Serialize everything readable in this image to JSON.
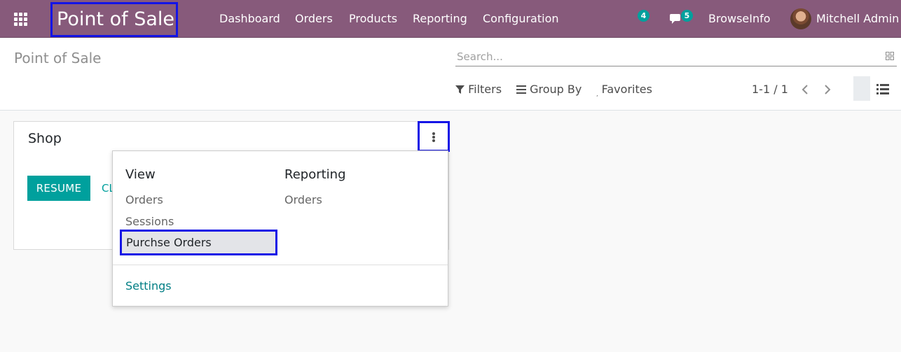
{
  "navbar": {
    "app_title": "Point of Sale",
    "menu": [
      "Dashboard",
      "Orders",
      "Products",
      "Reporting",
      "Configuration"
    ],
    "activity_count": "4",
    "message_count": "5",
    "company": "BrowseInfo",
    "user": "Mitchell Admin"
  },
  "control_panel": {
    "title": "Point of Sale",
    "search_placeholder": "Search...",
    "filters_label": "Filters",
    "group_by_label": "Group By",
    "favorites_label": "Favorites",
    "pager": "1-1 / 1"
  },
  "card": {
    "title": "Shop",
    "resume_label": "RESUME",
    "close_label": "CLOSE"
  },
  "dropdown": {
    "view_heading": "View",
    "view_items": [
      "Orders",
      "Sessions",
      "Purchse Orders"
    ],
    "reporting_heading": "Reporting",
    "reporting_items": [
      "Orders"
    ],
    "settings_label": "Settings"
  },
  "colors": {
    "navbar": "#875a7b",
    "accent": "#00a09d",
    "highlight_border": "#1414e6"
  }
}
